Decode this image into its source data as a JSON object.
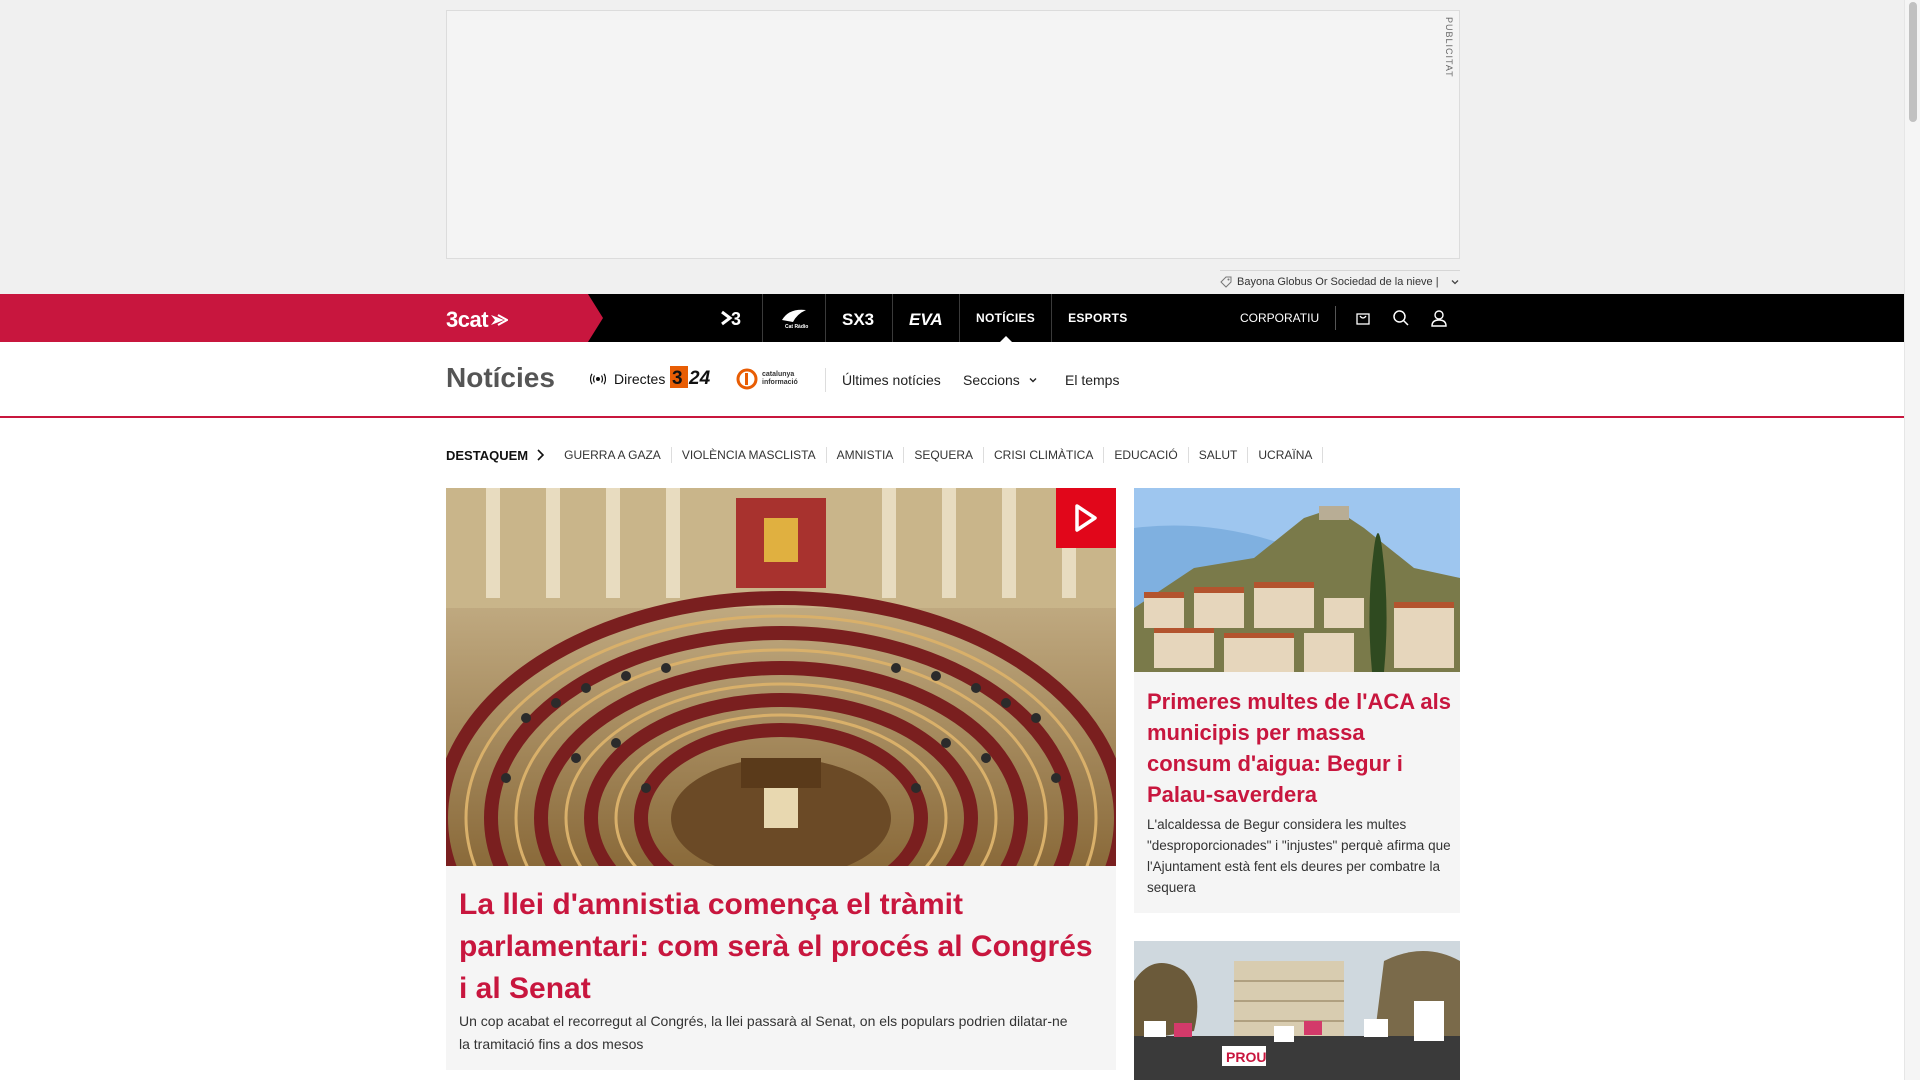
{
  "ad": {
    "label": "PUBLICITAT",
    "info_text": "Bayona Globus Or Sociedad de la nieve |"
  },
  "topnav": {
    "brand": "3cat",
    "channels": [
      {
        "label": "3",
        "icon": "tv3-logo-icon"
      },
      {
        "label": "Cat Ràdio",
        "icon": "catradio-logo-icon"
      },
      {
        "label": "SX3",
        "icon": "sx3-logo-icon"
      },
      {
        "label": "EVA",
        "icon": "eva-logo-icon"
      },
      {
        "label": "NOTÍCIES"
      },
      {
        "label": "ESPORTS"
      }
    ],
    "corporatiu": "CORPORATIU"
  },
  "section": {
    "title": "Notícies",
    "directes": "Directes",
    "logo_324": "324",
    "logo_ci": "catalunya informació",
    "links": {
      "ultimes": "Últimes notícies",
      "seccions": "Seccions",
      "temps": "El temps"
    }
  },
  "highlights": {
    "label": "DESTAQUEM",
    "items": [
      "GUERRA A GAZA",
      "VIOLÈNCIA MASCLISTA",
      "AMNISTIA",
      "SEQUERA",
      "CRISI CLIMÀTICA",
      "EDUCACIÓ",
      "SALUT",
      "UCRAÏNA"
    ]
  },
  "main_article": {
    "title": "La llei d'amnistia comença el tràmit parlamentari: com serà el procés al Congrés i al Senat",
    "summary": "Un cop acabat el recorregut al Congrés, la llei passarà al Senat, on els populars podrien dilatar-ne la tramitació fins a dos mesos"
  },
  "side_articles": [
    {
      "title": "Primeres multes de l'ACA als municipis per massa consum d'aigua: Begur i Palau-saverdera",
      "summary": "L'alcaldessa de Begur considera les multes \"desproporcionades\" i \"injustes\" perquè afirma que l'Ajuntament està fent els deures per combatre la sequera"
    },
    {
      "protest_sign": "PROU"
    }
  ],
  "colors": {
    "brand_red": "#c8163e",
    "play_red": "#e1061a",
    "nav_black": "#000000"
  }
}
